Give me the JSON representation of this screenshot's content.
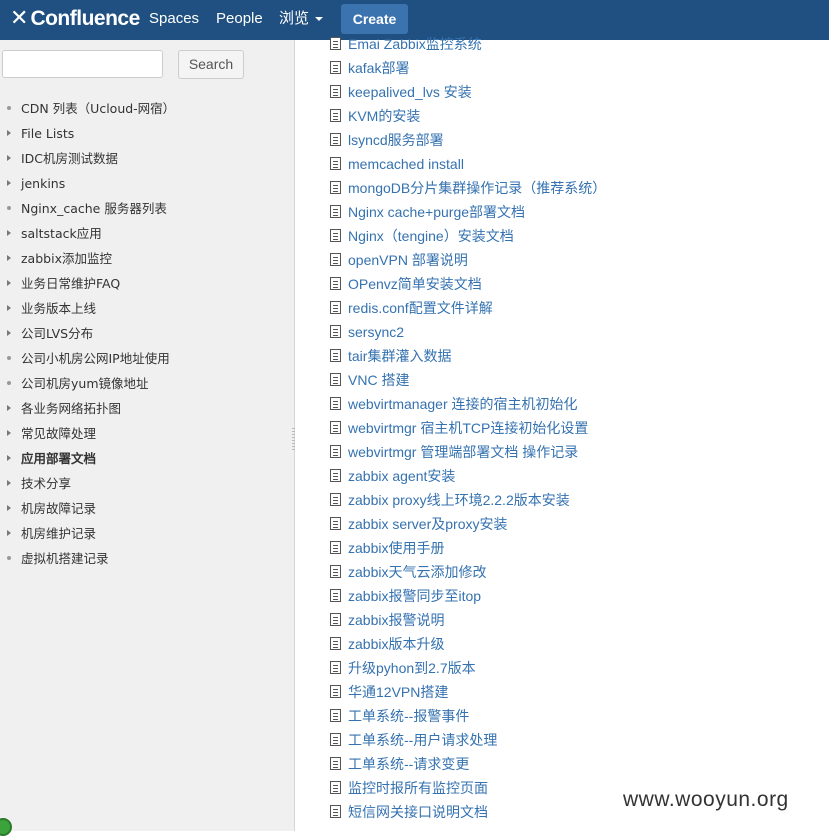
{
  "topnav": {
    "logo_text": "Confluence",
    "spaces": "Spaces",
    "people": "People",
    "browse": "浏览",
    "create": "Create"
  },
  "sidebar": {
    "search_value": "",
    "search_button": "Search",
    "items": [
      {
        "label": "CDN 列表（Ucloud-网宿）",
        "marker": "bullet"
      },
      {
        "label": "File Lists",
        "marker": "arrow"
      },
      {
        "label": "IDC机房测试数据",
        "marker": "arrow"
      },
      {
        "label": "jenkins",
        "marker": "arrow"
      },
      {
        "label": "Nginx_cache 服务器列表",
        "marker": "bullet"
      },
      {
        "label": "saltstack应用",
        "marker": "arrow"
      },
      {
        "label": "zabbix添加监控",
        "marker": "arrow"
      },
      {
        "label": "业务日常维护FAQ",
        "marker": "arrow"
      },
      {
        "label": "业务版本上线",
        "marker": "arrow"
      },
      {
        "label": "公司LVS分布",
        "marker": "arrow"
      },
      {
        "label": "公司小机房公网IP地址使用",
        "marker": "bullet"
      },
      {
        "label": "公司机房yum镜像地址",
        "marker": "bullet"
      },
      {
        "label": "各业务网络拓扑图",
        "marker": "arrow"
      },
      {
        "label": "常见故障处理",
        "marker": "arrow"
      },
      {
        "label": "应用部署文档",
        "marker": "arrow",
        "bold": true
      },
      {
        "label": "技术分享",
        "marker": "arrow"
      },
      {
        "label": "机房故障记录",
        "marker": "arrow"
      },
      {
        "label": "机房维护记录",
        "marker": "arrow"
      },
      {
        "label": "虚拟机搭建记录",
        "marker": "bullet"
      }
    ]
  },
  "pages": [
    "Emai Zabbix监控系统",
    "kafak部署",
    "keepalived_lvs 安装",
    "KVM的安装",
    "lsyncd服务部署",
    "memcached install",
    "mongoDB分片集群操作记录（推荐系统）",
    "Nginx cache+purge部署文档",
    "Nginx（tengine）安装文档",
    "openVPN 部署说明",
    "OPenvz简单安装文档",
    "redis.conf配置文件详解",
    "sersync2",
    "tair集群灌入数据",
    "VNC 搭建",
    "webvirtmanager 连接的宿主机初始化",
    "webvirtmgr 宿主机TCP连接初始化设置",
    "webvirtmgr 管理端部署文档 操作记录",
    "zabbix agent安装",
    "zabbix proxy线上环境2.2.2版本安装",
    "zabbix server及proxy安装",
    "zabbix使用手册",
    "zabbix天气云添加修改",
    "zabbix报警同步至itop",
    "zabbix报警说明",
    "zabbix版本升级",
    "升级pyhon到2.7版本",
    "华通12VPN搭建",
    "工单系统--报警事件",
    "工单系统--用户请求处理",
    "工单系统--请求变更",
    "监控时报所有监控页面",
    "短信网关接口说明文档"
  ],
  "watermark": "www.wooyun.org"
}
